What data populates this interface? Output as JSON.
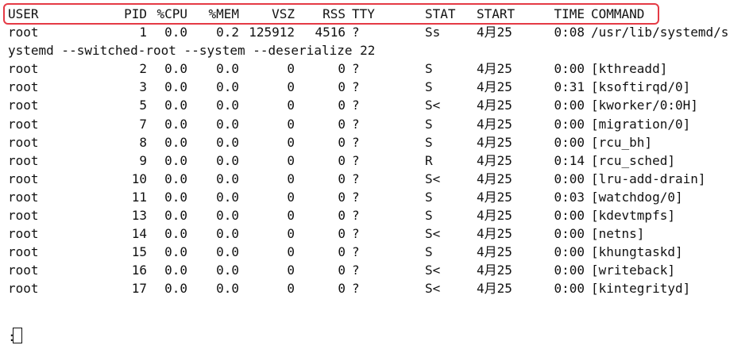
{
  "header": {
    "user": "USER",
    "pid": "PID",
    "cpu": "%CPU",
    "mem": "%MEM",
    "vsz": "VSZ",
    "rss": "RSS",
    "tty": "TTY",
    "stat": "STAT",
    "start": "START",
    "time": "TIME",
    "command": "COMMAND"
  },
  "rows": [
    {
      "user": "root",
      "pid": "1",
      "cpu": "0.0",
      "mem": "0.2",
      "vsz": "125912",
      "rss": "4516",
      "tty": "?",
      "stat": "Ss",
      "start": "4月25",
      "time": "0:08",
      "command": "/usr/lib/systemd/s"
    },
    {
      "wrap": "ystemd --switched-root --system --deserialize 22"
    },
    {
      "user": "root",
      "pid": "2",
      "cpu": "0.0",
      "mem": "0.0",
      "vsz": "0",
      "rss": "0",
      "tty": "?",
      "stat": "S",
      "start": "4月25",
      "time": "0:00",
      "command": "[kthreadd]"
    },
    {
      "user": "root",
      "pid": "3",
      "cpu": "0.0",
      "mem": "0.0",
      "vsz": "0",
      "rss": "0",
      "tty": "?",
      "stat": "S",
      "start": "4月25",
      "time": "0:31",
      "command": "[ksoftirqd/0]"
    },
    {
      "user": "root",
      "pid": "5",
      "cpu": "0.0",
      "mem": "0.0",
      "vsz": "0",
      "rss": "0",
      "tty": "?",
      "stat": "S<",
      "start": "4月25",
      "time": "0:00",
      "command": "[kworker/0:0H]"
    },
    {
      "user": "root",
      "pid": "7",
      "cpu": "0.0",
      "mem": "0.0",
      "vsz": "0",
      "rss": "0",
      "tty": "?",
      "stat": "S",
      "start": "4月25",
      "time": "0:00",
      "command": "[migration/0]"
    },
    {
      "user": "root",
      "pid": "8",
      "cpu": "0.0",
      "mem": "0.0",
      "vsz": "0",
      "rss": "0",
      "tty": "?",
      "stat": "S",
      "start": "4月25",
      "time": "0:00",
      "command": "[rcu_bh]"
    },
    {
      "user": "root",
      "pid": "9",
      "cpu": "0.0",
      "mem": "0.0",
      "vsz": "0",
      "rss": "0",
      "tty": "?",
      "stat": "R",
      "start": "4月25",
      "time": "0:14",
      "command": "[rcu_sched]"
    },
    {
      "user": "root",
      "pid": "10",
      "cpu": "0.0",
      "mem": "0.0",
      "vsz": "0",
      "rss": "0",
      "tty": "?",
      "stat": "S<",
      "start": "4月25",
      "time": "0:00",
      "command": "[lru-add-drain]"
    },
    {
      "user": "root",
      "pid": "11",
      "cpu": "0.0",
      "mem": "0.0",
      "vsz": "0",
      "rss": "0",
      "tty": "?",
      "stat": "S",
      "start": "4月25",
      "time": "0:03",
      "command": "[watchdog/0]"
    },
    {
      "user": "root",
      "pid": "13",
      "cpu": "0.0",
      "mem": "0.0",
      "vsz": "0",
      "rss": "0",
      "tty": "?",
      "stat": "S",
      "start": "4月25",
      "time": "0:00",
      "command": "[kdevtmpfs]"
    },
    {
      "user": "root",
      "pid": "14",
      "cpu": "0.0",
      "mem": "0.0",
      "vsz": "0",
      "rss": "0",
      "tty": "?",
      "stat": "S<",
      "start": "4月25",
      "time": "0:00",
      "command": "[netns]"
    },
    {
      "user": "root",
      "pid": "15",
      "cpu": "0.0",
      "mem": "0.0",
      "vsz": "0",
      "rss": "0",
      "tty": "?",
      "stat": "S",
      "start": "4月25",
      "time": "0:00",
      "command": "[khungtaskd]"
    },
    {
      "user": "root",
      "pid": "16",
      "cpu": "0.0",
      "mem": "0.0",
      "vsz": "0",
      "rss": "0",
      "tty": "?",
      "stat": "S<",
      "start": "4月25",
      "time": "0:00",
      "command": "[writeback]"
    },
    {
      "user": "root",
      "pid": "17",
      "cpu": "0.0",
      "mem": "0.0",
      "vsz": "0",
      "rss": "0",
      "tty": "?",
      "stat": "S<",
      "start": "4月25",
      "time": "0:00",
      "command": "[kintegrityd]"
    }
  ],
  "prompt": ":",
  "highlight_color": "#e53a45"
}
